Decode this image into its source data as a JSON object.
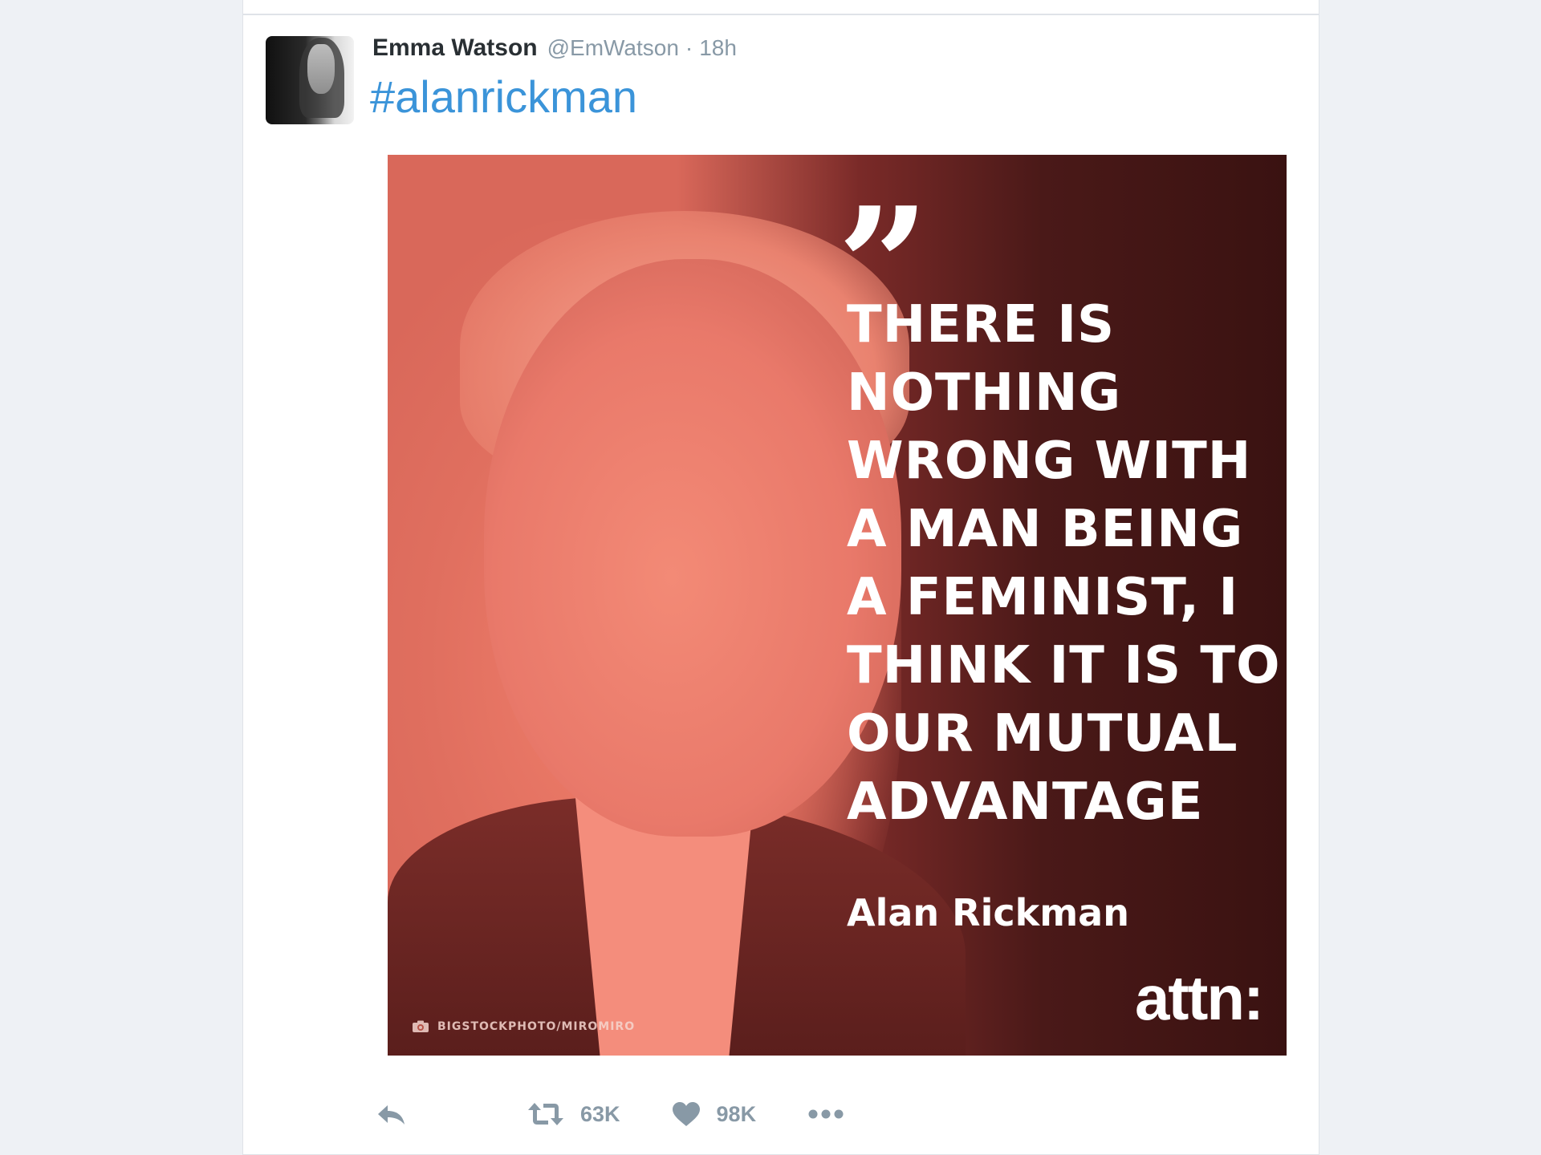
{
  "tweet": {
    "author": {
      "display_name": "Emma Watson",
      "handle": "@EmWatson",
      "separator": "·",
      "time": "18h"
    },
    "text": "#alanrickman",
    "media": {
      "quote_lines": [
        "THERE IS",
        "NOTHING",
        "WRONG WITH",
        "A MAN BEING",
        "A FEMINIST, I",
        "THINK IT IS TO",
        "OUR MUTUAL",
        "ADVANTAGE"
      ],
      "attribution": "Alan Rickman",
      "brand": "attn:",
      "credit": "BIGSTOCKPHOTO/MIROMIRO"
    },
    "actions": {
      "retweet_count": "63K",
      "like_count": "98K"
    }
  },
  "colors": {
    "hashtag": "#3b94d9",
    "muted": "#8899a6",
    "name": "#292f33",
    "media_tint": "#d9685a"
  },
  "icons": [
    "reply-icon",
    "retweet-icon",
    "heart-icon",
    "more-icon",
    "camera-icon"
  ]
}
